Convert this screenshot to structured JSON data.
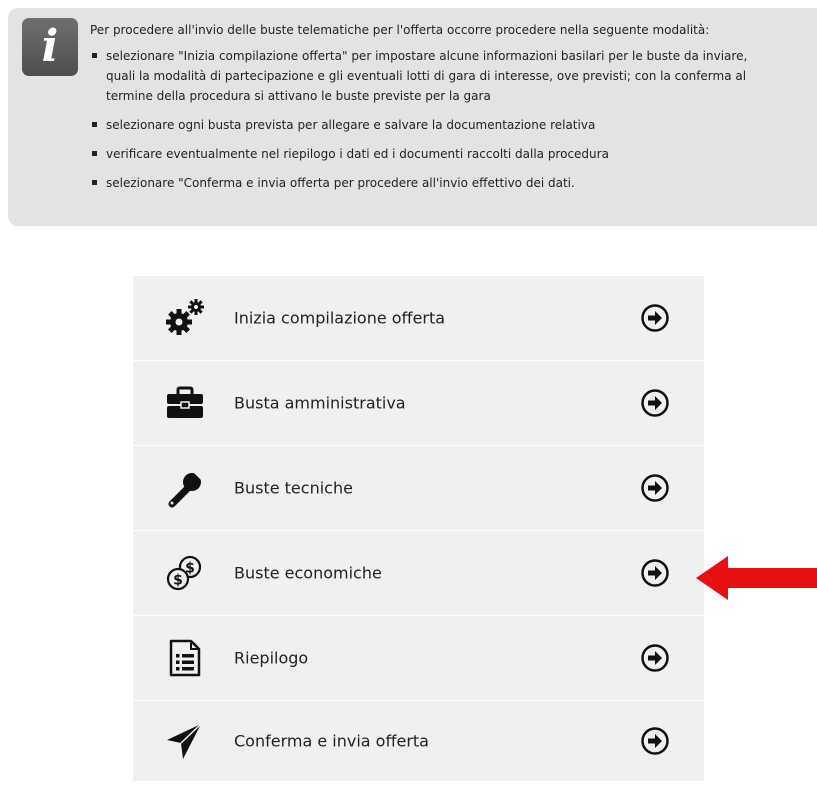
{
  "info": {
    "intro": "Per procedere all'invio delle buste telematiche per l'offerta occorre procedere nella seguente modalità:",
    "items": [
      "selezionare \"Inizia compilazione offerta\" per impostare alcune informazioni basilari per le buste da inviare,\nquali la modalità di partecipazione e gli eventuali lotti di gara di interesse, ove previsti; con la conferma al\ntermine della procedura si attivano le buste previste per la gara",
      "selezionare ogni busta prevista per allegare e salvare la documentazione relativa",
      "verificare eventualmente nel riepilogo i dati ed i documenti raccolti dalla procedura",
      "selezionare \"Conferma e invia offerta per procedere all'invio effettivo dei dati."
    ]
  },
  "menu": {
    "items": [
      {
        "label": "Inizia compilazione offerta",
        "icon": "gears-icon"
      },
      {
        "label": "Busta amministrativa",
        "icon": "briefcase-icon"
      },
      {
        "label": "Buste tecniche",
        "icon": "wrench-icon"
      },
      {
        "label": "Buste economiche",
        "icon": "money-icon"
      },
      {
        "label": "Riepilogo",
        "icon": "list-document-icon"
      },
      {
        "label": "Conferma e invia offerta",
        "icon": "paper-plane-icon"
      }
    ]
  },
  "colors": {
    "info_bg": "#e3e3e3",
    "menu_bg": "#f0f0f0",
    "pointer_arrow": "#e81010"
  }
}
